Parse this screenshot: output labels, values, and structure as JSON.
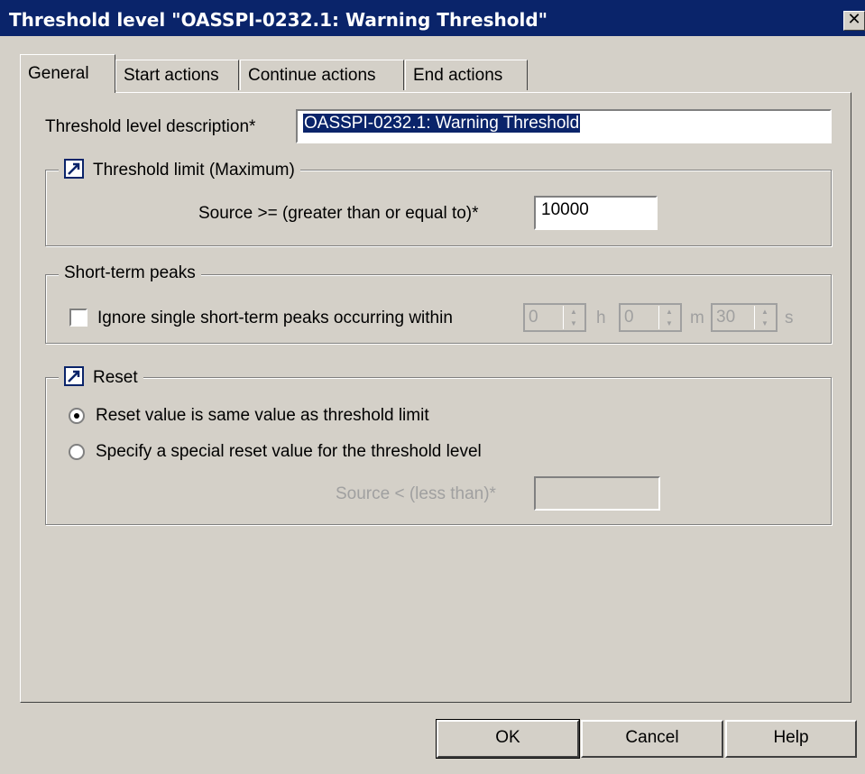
{
  "window": {
    "title": "Threshold level \"OASSPI-0232.1: Warning Threshold\"",
    "close_glyph": "✕"
  },
  "tabs": [
    {
      "label": "General",
      "active": true
    },
    {
      "label": "Start actions",
      "active": false
    },
    {
      "label": "Continue actions",
      "active": false
    },
    {
      "label": "End actions",
      "active": false
    }
  ],
  "description": {
    "label": "Threshold level description*",
    "value": "OASSPI-0232.1: Warning Threshold"
  },
  "threshold_limit": {
    "legend": "Threshold limit (Maximum)",
    "source_label": "Source >= (greater than or equal to)*",
    "value": "10000"
  },
  "short_term_peaks": {
    "legend": "Short-term peaks",
    "checkbox_label": "Ignore single short-term peaks occurring within",
    "checked": false,
    "hours": "0",
    "hours_unit": "h",
    "minutes": "0",
    "minutes_unit": "m",
    "seconds": "30",
    "seconds_unit": "s"
  },
  "reset": {
    "legend": "Reset",
    "option_same": "Reset value is same value as threshold limit",
    "option_special": "Specify a special reset value for the threshold level",
    "selected": "same",
    "source_label": "Source < (less than)*",
    "value": ""
  },
  "buttons": {
    "ok": "OK",
    "cancel": "Cancel",
    "help": "Help"
  },
  "colors": {
    "titlebar": "#0a246a",
    "dialog_bg": "#d4d0c8",
    "selection": "#0a246a"
  }
}
